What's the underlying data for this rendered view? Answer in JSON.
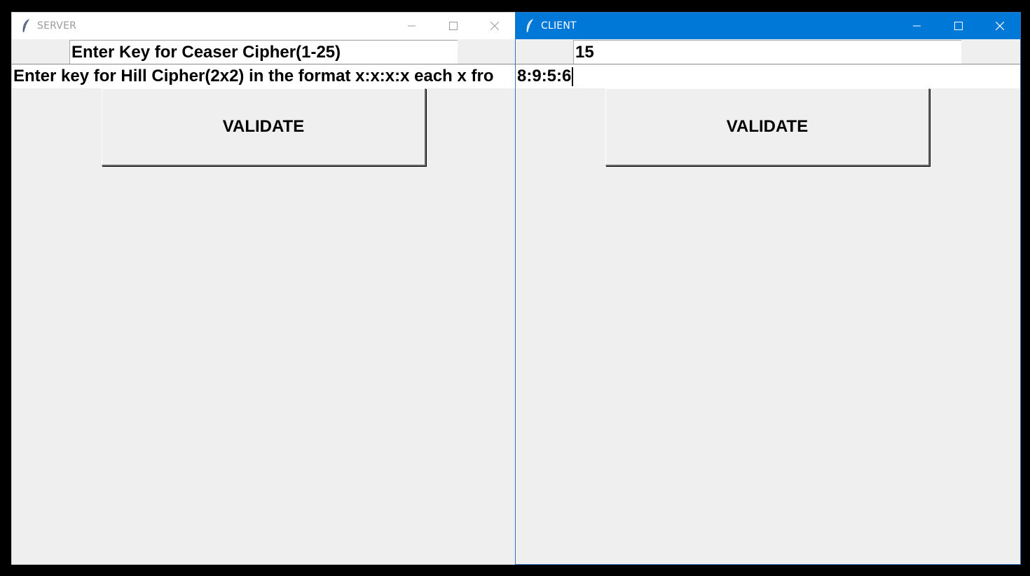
{
  "server": {
    "title": "SERVER",
    "caesar_field_value": "Enter Key for Ceaser Cipher(1-25)",
    "hill_field_value": "Enter key for Hill Cipher(2x2) in the format x:x:x:x each x fro",
    "validate_label": "VALIDATE"
  },
  "client": {
    "title": "CLIENT",
    "caesar_field_value": "15",
    "hill_field_value": "8:9:5:6",
    "validate_label": "VALIDATE"
  },
  "icons": {
    "app": "feather-icon",
    "minimize": "minimize-icon",
    "maximize": "maximize-icon",
    "close": "close-icon"
  },
  "colors": {
    "active_titlebar": "#0078d7",
    "inactive_titlebar": "#ffffff",
    "window_bg": "#efefef",
    "desktop": "#000000"
  }
}
